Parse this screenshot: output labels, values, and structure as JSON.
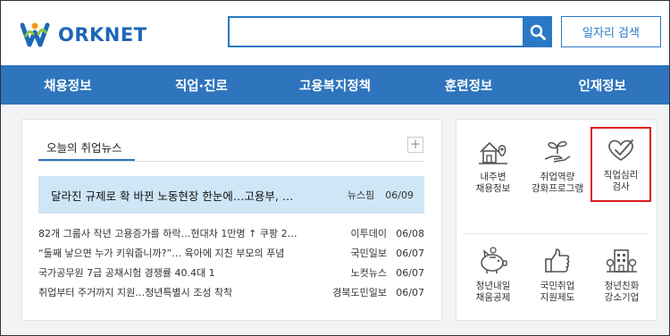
{
  "header": {
    "logo_text": "ORKNET",
    "search_placeholder": "",
    "search_icon": "search-icon",
    "job_search_label": "일자리 검색"
  },
  "nav": {
    "items": [
      {
        "label": "채용정보"
      },
      {
        "label": "직업·진로"
      },
      {
        "label": "고용복지정책"
      },
      {
        "label": "훈련정보"
      },
      {
        "label": "인재정보"
      }
    ]
  },
  "news": {
    "tab_label": "오늘의 취업뉴스",
    "more_label": "+",
    "headline": {
      "title": "달라진 규제로 확 바뀐 노동현장 한눈에…고용부, …",
      "source": "뉴스핌",
      "date": "06/09"
    },
    "items": [
      {
        "title": "82개 그룹사 작년 고용증가를 하락…현대차 1만명 ↑ 쿠팡 2…",
        "source": "이투데이",
        "date": "06/08"
      },
      {
        "title": "“둘째 낳으면 누가 키워줍니까?”… 육아에 지친 부모의 푸념",
        "source": "국민일보",
        "date": "06/07"
      },
      {
        "title": "국가공무원 7급 공채시험 경쟁률 40.4대 1",
        "source": "노컷뉴스",
        "date": "06/07"
      },
      {
        "title": "취업부터 주거까지 지원…청년특별시 조성 착착",
        "source": "경북도민일보",
        "date": "06/07"
      }
    ]
  },
  "services": {
    "items": [
      {
        "icon": "house-map-icon",
        "line1": "내주변",
        "line2": "채용정보"
      },
      {
        "icon": "sprout-hand-icon",
        "line1": "취업역량",
        "line2": "강화프로그램"
      },
      {
        "icon": "heart-check-icon",
        "line1": "직업심리",
        "line2": "검사"
      },
      {
        "icon": "piggy-bank-icon",
        "line1": "청년내일",
        "line2": "채움공제"
      },
      {
        "icon": "thumbs-up-icon",
        "line1": "국민취업",
        "line2": "지원제도"
      },
      {
        "icon": "building-tree-icon",
        "line1": "청년친화",
        "line2": "강소기업"
      }
    ],
    "highlight_color": "#d9211c"
  },
  "colors": {
    "brand_blue": "#2e75bd",
    "headline_bg": "#cfe6f7",
    "logo_green": "#8cc63f",
    "logo_orange": "#f39a1e"
  }
}
